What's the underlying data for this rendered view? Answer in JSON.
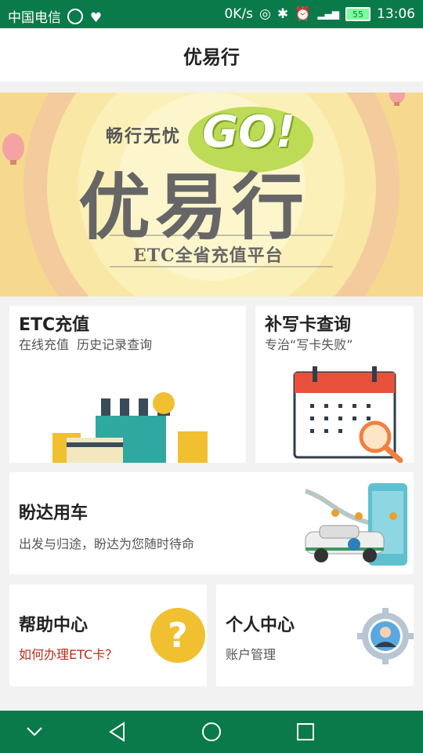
{
  "status": {
    "carrier": "中国电信",
    "net_speed": "0K/s",
    "battery_level": "55",
    "time": "13:06"
  },
  "header": {
    "title": "优易行"
  },
  "banner": {
    "slogan": "畅行无忧",
    "go_text": "GO!",
    "brand": "优易行",
    "tagline": "ETC全省充值平台"
  },
  "cards": {
    "etc_recharge": {
      "title": "ETC充值",
      "subtitle": "在线充值  历史记录查询"
    },
    "rewrite_card": {
      "title": "补写卡查询",
      "subtitle": "专治“写卡失败”"
    },
    "panda": {
      "title": "盼达用车",
      "subtitle": "出发与归途，盼达为您随时待命"
    },
    "help": {
      "title": "帮助中心",
      "subtitle": "如何办理ETC卡？"
    },
    "personal": {
      "title": "个人中心",
      "subtitle": "账户管理"
    }
  },
  "colors": {
    "status_bar": "#0a7a4a",
    "nav_bar": "#0a7a4a",
    "help_link": "#c02a1a",
    "question_badge": "#f0c030"
  }
}
